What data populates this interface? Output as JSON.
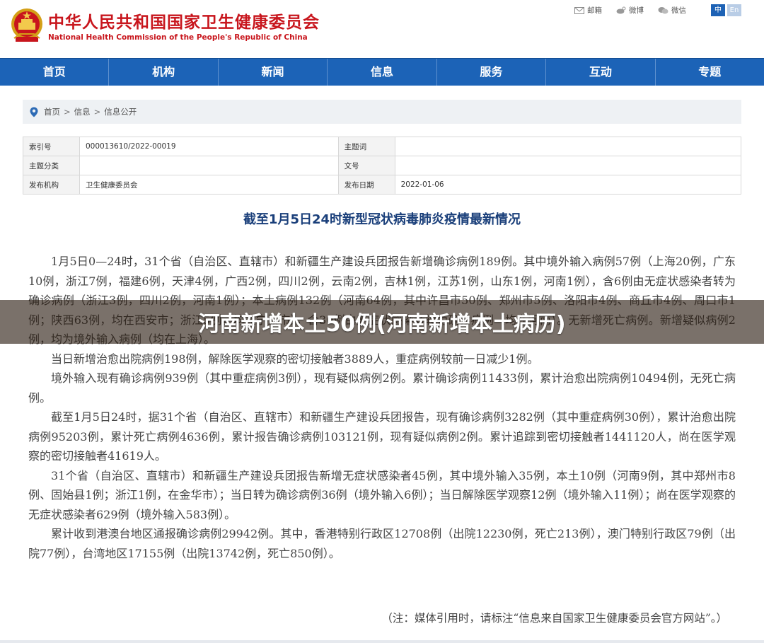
{
  "header": {
    "title": "中华人民共和国国家卫生健康委员会",
    "subtitle": "National Health Commission of the People's Republic of China",
    "links": [
      {
        "label": "邮箱",
        "icon": "mail-icon"
      },
      {
        "label": "微博",
        "icon": "weibo-icon"
      },
      {
        "label": "微信",
        "icon": "wechat-icon"
      }
    ],
    "lang_zh": "中",
    "lang_en": "En",
    "brand_color": "#c8161d"
  },
  "nav": {
    "color": "#1c63b7",
    "items": [
      "首页",
      "机构",
      "新闻",
      "信息",
      "服务",
      "互动",
      "专题"
    ]
  },
  "breadcrumb": {
    "items": [
      "首页",
      "信息",
      "信息公开"
    ],
    "separator": ">"
  },
  "info_table": {
    "index_label": "索引号",
    "index_value": "000013610/2022-00019",
    "keyword_label": "主题词",
    "keyword_value": "",
    "category_label": "主题分类",
    "category_value": "",
    "doc_label": "文号",
    "doc_value": "",
    "publisher_label": "发布机构",
    "publisher_value": "卫生健康委员会",
    "date_label": "发布日期",
    "date_value": "2022-01-06"
  },
  "article": {
    "title": "截至1月5日24时新型冠状病毒肺炎疫情最新情况",
    "paragraphs": [
      "1月5日0—24时，31个省（自治区、直辖市）和新疆生产建设兵团报告新增确诊病例189例。其中境外输入病例57例（上海20例，广东10例，浙江7例，福建6例，天津4例，广西2例，四川2例，云南2例，吉林1例，江苏1例，山东1例，河南1例），含6例由无症状感染者转为确诊病例（浙江3例，四川2例，河南1例）；本土病例132例（河南64例，其中许昌市50例、郑州市5例、洛阳市4例、商丘市4例、周口市1例；陕西63例，均在西安市；浙江5例，均在宁波市），含30例由无症状感染者转为确诊病例（均在河南）。无新增死亡病例。新增疑似病例2例，均为境外输入病例（均在上海）。",
      "当日新增治愈出院病例198例，解除医学观察的密切接触者3889人，重症病例较前一日减少1例。",
      "境外输入现有确诊病例939例（其中重症病例3例），现有疑似病例2例。累计确诊病例11433例，累计治愈出院病例10494例，无死亡病例。",
      "截至1月5日24时，据31个省（自治区、直辖市）和新疆生产建设兵团报告，现有确诊病例3282例（其中重症病例30例），累计治愈出院病例95203例，累计死亡病例4636例，累计报告确诊病例103121例，现有疑似病例2例。累计追踪到密切接触者1441120人，尚在医学观察的密切接触者41619人。",
      "31个省（自治区、直辖市）和新疆生产建设兵团报告新增无症状感染者45例，其中境外输入35例，本土10例（河南9例，其中郑州市8例、固始县1例；浙江1例，在金华市）；当日转为确诊病例36例（境外输入6例）；当日解除医学观察12例（境外输入11例）；尚在医学观察的无症状感染者629例（境外输入583例）。",
      "累计收到港澳台地区通报确诊病例29942例。其中，香港特别行政区12708例（出院12230例，死亡213例），澳门特别行政区79例（出院77例），台湾地区17155例（出院13742例，死亡850例）。"
    ],
    "note": "（注：媒体引用时，请标注“信息来自国家卫生健康委员会官方网站”。）"
  },
  "overlay": {
    "text": "河南新增本土50例(河南新增本土病历)"
  }
}
